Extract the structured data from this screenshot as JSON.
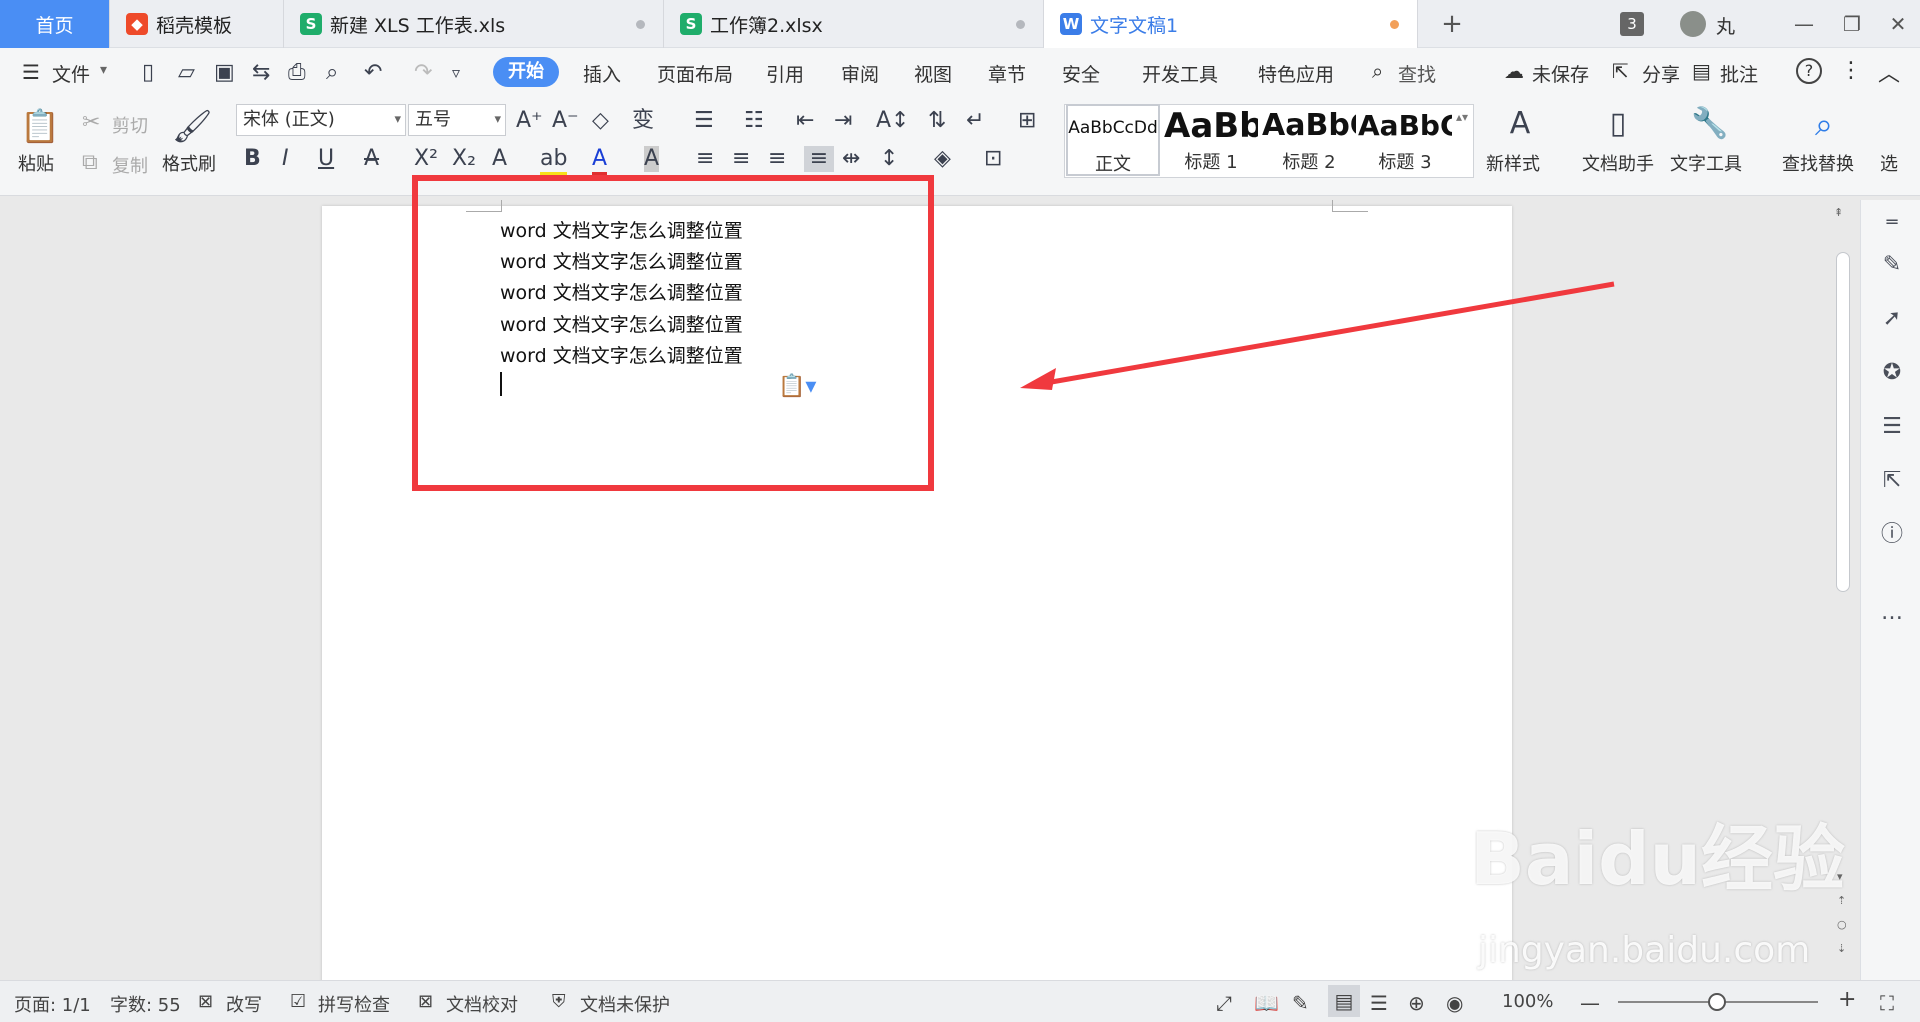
{
  "titlebar": {
    "tabs": [
      {
        "label": "首页"
      },
      {
        "label": "稻壳模板"
      },
      {
        "label": "新建 XLS 工作表.xls"
      },
      {
        "label": "工作簿2.xlsx"
      },
      {
        "label": "文字文稿1"
      }
    ],
    "window_count": "3",
    "user_name": "丸"
  },
  "menubar": {
    "file": "文件",
    "items": [
      "开始",
      "插入",
      "页面布局",
      "引用",
      "审阅",
      "视图",
      "章节",
      "安全",
      "开发工具",
      "特色应用"
    ],
    "search": "查找",
    "unsaved": "未保存",
    "share": "分享",
    "comment": "批注"
  },
  "ribbon": {
    "paste": "粘贴",
    "cut": "剪切",
    "copy": "复制",
    "format_painter": "格式刷",
    "font_name": "宋体 (正文)",
    "font_size": "五号",
    "styles": [
      {
        "preview": "AaBbCcDd",
        "name": "正文"
      },
      {
        "preview": "AaBb",
        "name": "标题 1"
      },
      {
        "preview": "AaBbC",
        "name": "标题 2"
      },
      {
        "preview": "AaBbC",
        "name": "标题 3"
      }
    ],
    "new_style": "新样式",
    "doc_assistant": "文档助手",
    "text_tools": "文字工具",
    "find_replace": "查找替换",
    "select": "选"
  },
  "document": {
    "lines": [
      "word 文档文字怎么调整位置",
      "word 文档文字怎么调整位置",
      "word 文档文字怎么调整位置",
      "word 文档文字怎么调整位置",
      "word 文档文字怎么调整位置"
    ]
  },
  "statusbar": {
    "page": "页面: 1/1",
    "word_count": "字数: 55",
    "overwrite": "改写",
    "spell_check": "拼写检查",
    "doc_proofread": "文档校对",
    "protection": "文档未保护",
    "zoom": "100%"
  },
  "watermark": {
    "logo": "Baidu经验",
    "url": "jingyan.baidu.com"
  },
  "colors": {
    "accent": "#4a8ef4",
    "highlight_box": "#f0393e",
    "page": "#ffffff"
  }
}
